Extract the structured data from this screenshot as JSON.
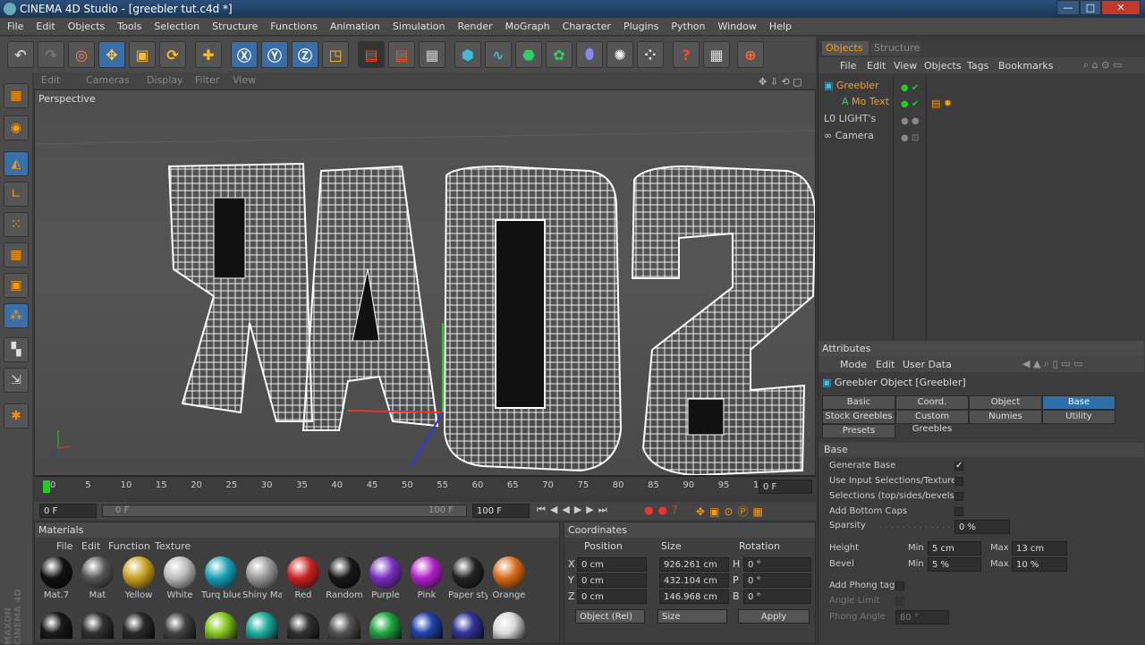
{
  "window": {
    "title": "CINEMA 4D Studio - [greebler tut.c4d *]",
    "minimize": "—",
    "maximize": "□",
    "close": "✕"
  },
  "menu": [
    "File",
    "Edit",
    "Objects",
    "Tools",
    "Selection",
    "Structure",
    "Functions",
    "Animation",
    "Simulation",
    "Render",
    "MoGraph",
    "Character",
    "Plugins",
    "Python",
    "Window",
    "Help"
  ],
  "viewport": {
    "menu": [
      "Edit",
      "Cameras",
      "Display",
      "Filter",
      "View"
    ],
    "label": "Perspective"
  },
  "timeline": {
    "ticks": [
      "0",
      "5",
      "10",
      "15",
      "20",
      "25",
      "30",
      "35",
      "40",
      "45",
      "50",
      "55",
      "60",
      "65",
      "70",
      "75",
      "80",
      "85",
      "90",
      "95",
      "100"
    ],
    "frame_display": "0 F"
  },
  "transport": {
    "start_field": "0 F",
    "slider_left": "0 F",
    "slider_right": "100 F",
    "end_field": "100 F"
  },
  "materials": {
    "title": "Materials",
    "menu": [
      "File",
      "Edit",
      "Function",
      "Texture"
    ],
    "items": [
      {
        "name": "Mat.7",
        "color": "#111111"
      },
      {
        "name": "Mat",
        "color": "#555555"
      },
      {
        "name": "Yellow",
        "color": "#c8a020"
      },
      {
        "name": "White",
        "color": "#bbbbbb"
      },
      {
        "name": "Turq blue",
        "color": "#1aa0b8"
      },
      {
        "name": "Shiny Ma",
        "color": "#999999"
      },
      {
        "name": "Red",
        "color": "#cc2222"
      },
      {
        "name": "Random",
        "color": "#181818"
      },
      {
        "name": "Purple",
        "color": "#7a2fc0"
      },
      {
        "name": "Pink",
        "color": "#b020c8"
      },
      {
        "name": "Paper sty",
        "color": "#222222"
      },
      {
        "name": "Orange",
        "color": "#d86a18"
      }
    ],
    "second_row_colors": [
      "#1a1a1a",
      "#333333",
      "#2a2a2a",
      "#444444",
      "#88cc22",
      "#22b0a0",
      "#333333",
      "#555555",
      "#22aa44",
      "#2244aa",
      "#333399",
      "#dddddd"
    ]
  },
  "coordinates": {
    "title": "Coordinates",
    "headers": [
      "Position",
      "Size",
      "Rotation"
    ],
    "rows": [
      {
        "axis": "X",
        "pos": "0 cm",
        "size": "926.261 cm",
        "rot_axis": "H",
        "rot": "0 °"
      },
      {
        "axis": "Y",
        "pos": "0 cm",
        "size": "432.104 cm",
        "rot_axis": "P",
        "rot": "0 °"
      },
      {
        "axis": "Z",
        "pos": "0 cm",
        "size": "146.968 cm",
        "rot_axis": "B",
        "rot": "0 °"
      }
    ],
    "mode_select": "Object (Rel)",
    "size_select": "Size",
    "apply": "Apply"
  },
  "objects": {
    "tabs": [
      "Objects",
      "Structure"
    ],
    "menu": [
      "File",
      "Edit",
      "View",
      "Objects",
      "Tags",
      "Bookmarks"
    ],
    "items": [
      {
        "name": "Greebler",
        "color": "#f0a030"
      },
      {
        "name": "Mo Text",
        "color": "#f0a030"
      },
      {
        "name": "LIGHT's",
        "color": "#cccccc"
      },
      {
        "name": "Camera",
        "color": "#cccccc"
      }
    ]
  },
  "attributes": {
    "title": "Attributes",
    "menu": [
      "Mode",
      "Edit",
      "User Data"
    ],
    "object_title": "Greebler Object [Greebler]",
    "tabs_row1": [
      "Basic",
      "Coord.",
      "Object",
      "Base"
    ],
    "tabs_row2": [
      "Stock Greebles",
      "Custom Greebles",
      "Numies",
      "Utility"
    ],
    "tabs_row3": [
      "Presets"
    ],
    "section": "Base",
    "checks": [
      {
        "label": "Generate Base",
        "checked": "✓"
      },
      {
        "label": "Use Input Selections/Textures",
        "checked": ""
      },
      {
        "label": "Selections (top/sides/bevels)",
        "checked": ""
      },
      {
        "label": "Add Bottom Caps",
        "checked": ""
      }
    ],
    "sparsity_label": "Sparsity",
    "sparsity": "0 %",
    "height_label": "Height",
    "height_min": "5 cm",
    "height_max": "13 cm",
    "bevel_label": "Bevel",
    "bevel_min": "5 %",
    "bevel_max": "10 %",
    "min_label": "Min",
    "max_label": "Max",
    "phong_label": "Add Phong tag",
    "angle_limit_label": "Angle Limit",
    "phong_angle_label": "Phong Angle",
    "phong_angle": "80 °"
  },
  "branding": "MAXON CINEMA 4D"
}
